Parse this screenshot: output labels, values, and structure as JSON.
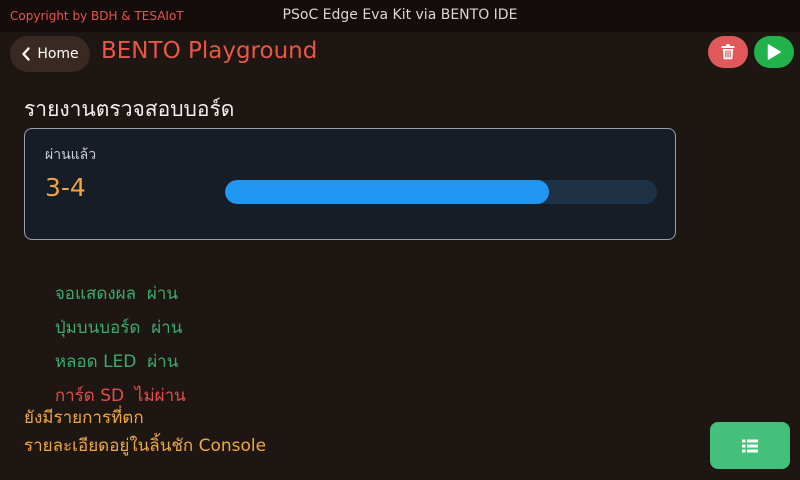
{
  "topbar": {
    "copyright": "Copyright by BDH & TESAIoT",
    "window_title": "PSoC Edge Eva Kit via BENTO IDE"
  },
  "header": {
    "home_label": "Home",
    "app_title": "BENTO Playground",
    "home_icon": "chevron-left-icon",
    "delete_icon": "trash-icon",
    "run_icon": "play-icon"
  },
  "report": {
    "title": "รายงานตรวจสอบบอร์ด",
    "summary_label": "ผ่านแล้ว",
    "summary_value": "3-4",
    "progress_fraction": 0.75,
    "results": [
      {
        "item": "จอแสดงผล",
        "status": "ผ่าน",
        "passed": true
      },
      {
        "item": "ปุ่มบนบอร์ด",
        "status": "ผ่าน",
        "passed": true
      },
      {
        "item": "หลอด LED",
        "status": "ผ่าน",
        "passed": true
      },
      {
        "item": "การ์ด SD",
        "status": "ไม่ผ่าน",
        "passed": false
      }
    ],
    "note_line1": "ยังมีรายการที่ตก",
    "note_line2": "รายละเอียดอยู่ในลิ้นชัก Console"
  },
  "footer": {
    "console_icon": "list-icon"
  },
  "colors": {
    "accent_red": "#e95745",
    "pass_green": "#3cab6e",
    "fail_red": "#e24e4b",
    "warning_orange": "#f2a93c",
    "progress_blue": "#2196f3"
  }
}
